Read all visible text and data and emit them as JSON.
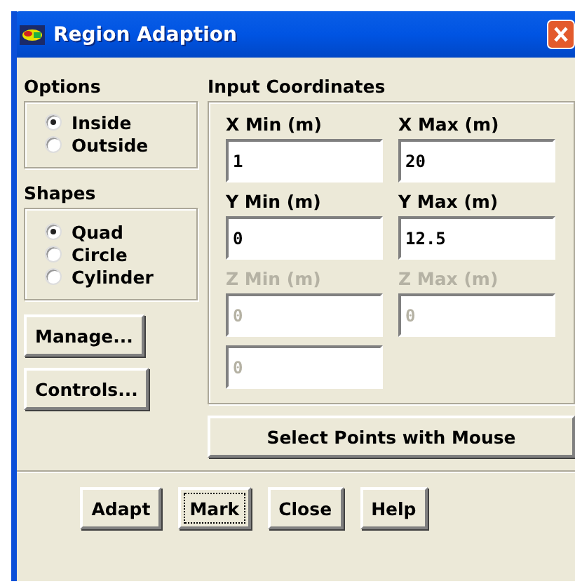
{
  "window": {
    "title": "Region Adaption"
  },
  "options": {
    "label": "Options",
    "items": [
      {
        "label": "Inside",
        "selected": true
      },
      {
        "label": "Outside",
        "selected": false
      }
    ]
  },
  "shapes": {
    "label": "Shapes",
    "items": [
      {
        "label": "Quad",
        "selected": true
      },
      {
        "label": "Circle",
        "selected": false
      },
      {
        "label": "Cylinder",
        "selected": false
      }
    ]
  },
  "side_buttons": [
    "Manage...",
    "Controls..."
  ],
  "input_coordinates": {
    "label": "Input Coordinates",
    "fields": [
      {
        "label": "X Min (m)",
        "value": "1",
        "disabled": false
      },
      {
        "label": "X Max (m)",
        "value": "20",
        "disabled": false
      },
      {
        "label": "Y Min (m)",
        "value": "0",
        "disabled": false
      },
      {
        "label": "Y Max (m)",
        "value": "12.5",
        "disabled": false
      },
      {
        "label": "Z Min (m)",
        "value": "0",
        "disabled": true
      },
      {
        "label": "Z Max (m)",
        "value": "0",
        "disabled": true
      },
      {
        "value": "0",
        "disabled": true
      }
    ]
  },
  "select_button": "Select Points with Mouse",
  "buttons": [
    {
      "label": "Adapt",
      "focused": false
    },
    {
      "label": "Mark",
      "focused": true
    },
    {
      "label": "Close",
      "focused": false
    },
    {
      "label": "Help",
      "focused": false
    }
  ]
}
